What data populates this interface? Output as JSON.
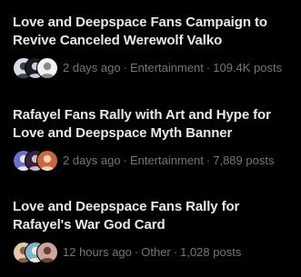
{
  "trending": [
    {
      "title": "Love and Deepspace Fans Campaign to Revive Canceled Werewolf Valko",
      "time": "2 days ago",
      "category": "Entertainment",
      "posts": "109.4K posts",
      "avatars": [
        {
          "icon": "avatar-photo-icon",
          "bg": "#d8dbe0",
          "fg": "#3b4150"
        },
        {
          "icon": "avatar-photo-icon",
          "bg": "#1c1a22",
          "fg": "#cfc8d6"
        },
        {
          "icon": "avatar-photo-icon",
          "bg": "#f2f2f2",
          "fg": "#8a8a8a"
        }
      ]
    },
    {
      "title": "Rafayel Fans Rally with Art and Hype for Love and Deepspace Myth Banner",
      "time": "2 days ago",
      "category": "Entertainment",
      "posts": "7,889 posts",
      "avatars": [
        {
          "icon": "avatar-photo-icon",
          "bg": "#6a6fd0",
          "fg": "#e8e3f6"
        },
        {
          "icon": "avatar-photo-icon",
          "bg": "#33253a",
          "fg": "#d9b6c8"
        },
        {
          "icon": "avatar-photo-icon",
          "bg": "#c7683e",
          "fg": "#f5d1b4"
        }
      ]
    },
    {
      "title": "Love and Deepspace Fans Rally for Rafayel's War God Card",
      "time": "12 hours ago",
      "category": "Other",
      "posts": "1,028 posts",
      "avatars": [
        {
          "icon": "avatar-photo-icon",
          "bg": "#e3c9a8",
          "fg": "#8f5b45"
        },
        {
          "icon": "avatar-photo-icon",
          "bg": "#7ab7c9",
          "fg": "#f2e4da"
        },
        {
          "icon": "avatar-photo-icon",
          "bg": "#caa6a0",
          "fg": "#6e3f3a"
        }
      ]
    }
  ]
}
